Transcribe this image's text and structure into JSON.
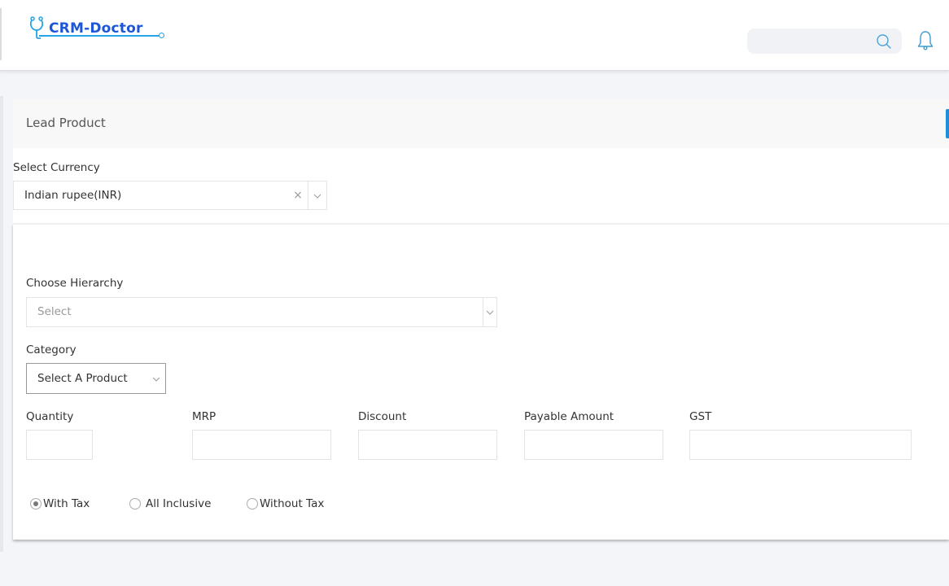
{
  "header": {
    "logo_text": "CRM-Doctor",
    "search": {
      "placeholder": "",
      "value": ""
    }
  },
  "colors": {
    "brand_blue": "#1d57d6",
    "brand_cyan": "#27a3e6",
    "accent": "#1a8fe0"
  },
  "panel": {
    "title": "Lead Product"
  },
  "currency": {
    "label": "Select Currency",
    "value": "Indian rupee(INR)"
  },
  "form": {
    "hierarchy": {
      "label": "Choose Hierarchy",
      "placeholder": "Select"
    },
    "category": {
      "label": "Category",
      "value": "Select A Product"
    },
    "fields": [
      {
        "label": "Quantity",
        "value": ""
      },
      {
        "label": "MRP",
        "value": ""
      },
      {
        "label": "Discount",
        "value": ""
      },
      {
        "label": "Payable Amount",
        "value": ""
      },
      {
        "label": "GST",
        "value": ""
      }
    ],
    "tax_options": [
      {
        "label": "With Tax",
        "checked": true
      },
      {
        "label": "All Inclusive",
        "checked": false
      },
      {
        "label": "Without Tax",
        "checked": false
      }
    ]
  },
  "icons": {
    "logo": "stethoscope-icon",
    "search": "search-icon",
    "notifications": "bell-icon",
    "clear": "close-icon",
    "dropdown": "chevron-down-icon"
  }
}
